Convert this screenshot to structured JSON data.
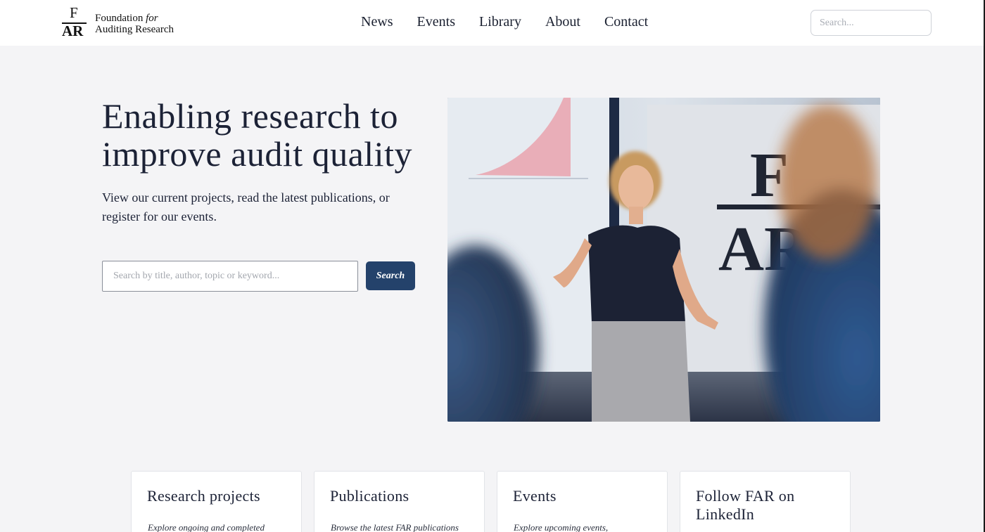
{
  "header": {
    "logo": {
      "mark_top": "F",
      "mark_bottom": "AR",
      "name_line1_prefix": "Foundation ",
      "name_line1_italic": "for",
      "name_line2": "Auditing Research"
    },
    "nav": [
      "News",
      "Events",
      "Library",
      "About",
      "Contact"
    ],
    "search_placeholder": "Search..."
  },
  "hero": {
    "title": "Enabling research to improve audit quality",
    "subtitle": "View our current projects, read the latest publications, or register for our events.",
    "search_placeholder": "Search by title, author, topic or keyword...",
    "search_button": "Search",
    "image_alt": "Woman presenting in front of a screen with the FAR logo"
  },
  "cards": [
    {
      "title": "Research projects",
      "desc": "Explore ongoing and completed"
    },
    {
      "title": "Publications",
      "desc": "Browse the latest FAR publications"
    },
    {
      "title": "Events",
      "desc": "Explore upcoming events,"
    },
    {
      "title": "Follow FAR on LinkedIn",
      "desc": ""
    }
  ],
  "colors": {
    "page_bg": "#f4f4f6",
    "header_bg": "#ffffff",
    "text": "#1c2236",
    "button": "#24426b"
  }
}
